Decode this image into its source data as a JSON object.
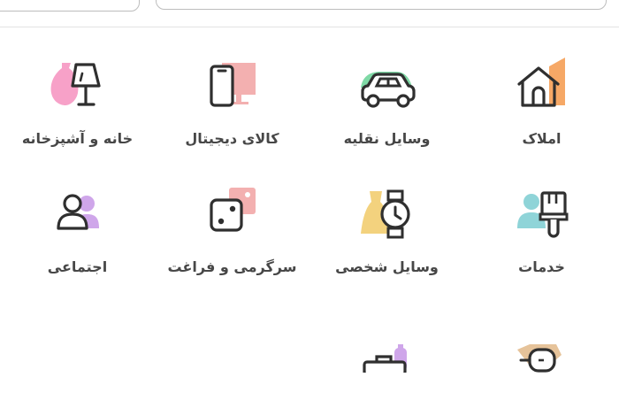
{
  "colors": {
    "stroke": "#2f2f2f",
    "orange": "#f6a866",
    "pink": "#f7a1c8",
    "salmon": "#f3b0b0",
    "green": "#7fd9a6",
    "yellow": "#f3d27e",
    "teal": "#8fd4d8",
    "purple": "#cfa6ea",
    "tan": "#e6c39a"
  },
  "categories": [
    {
      "label": "املاک",
      "icon": "house-icon"
    },
    {
      "label": "وسایل نقلیه",
      "icon": "car-icon"
    },
    {
      "label": "کالای دیجیتال",
      "icon": "phone-icon"
    },
    {
      "label": "خانه و آشپزخانه",
      "icon": "lamp-icon"
    },
    {
      "label": "خدمات",
      "icon": "paint-brush-icon"
    },
    {
      "label": "وسایل شخصی",
      "icon": "watch-icon"
    },
    {
      "label": "سرگرمی و فراغت",
      "icon": "dice-icon"
    },
    {
      "label": "اجتماعی",
      "icon": "people-icon"
    },
    {
      "label": "",
      "icon": "drill-icon"
    },
    {
      "label": "",
      "icon": "toolbox-icon"
    }
  ]
}
